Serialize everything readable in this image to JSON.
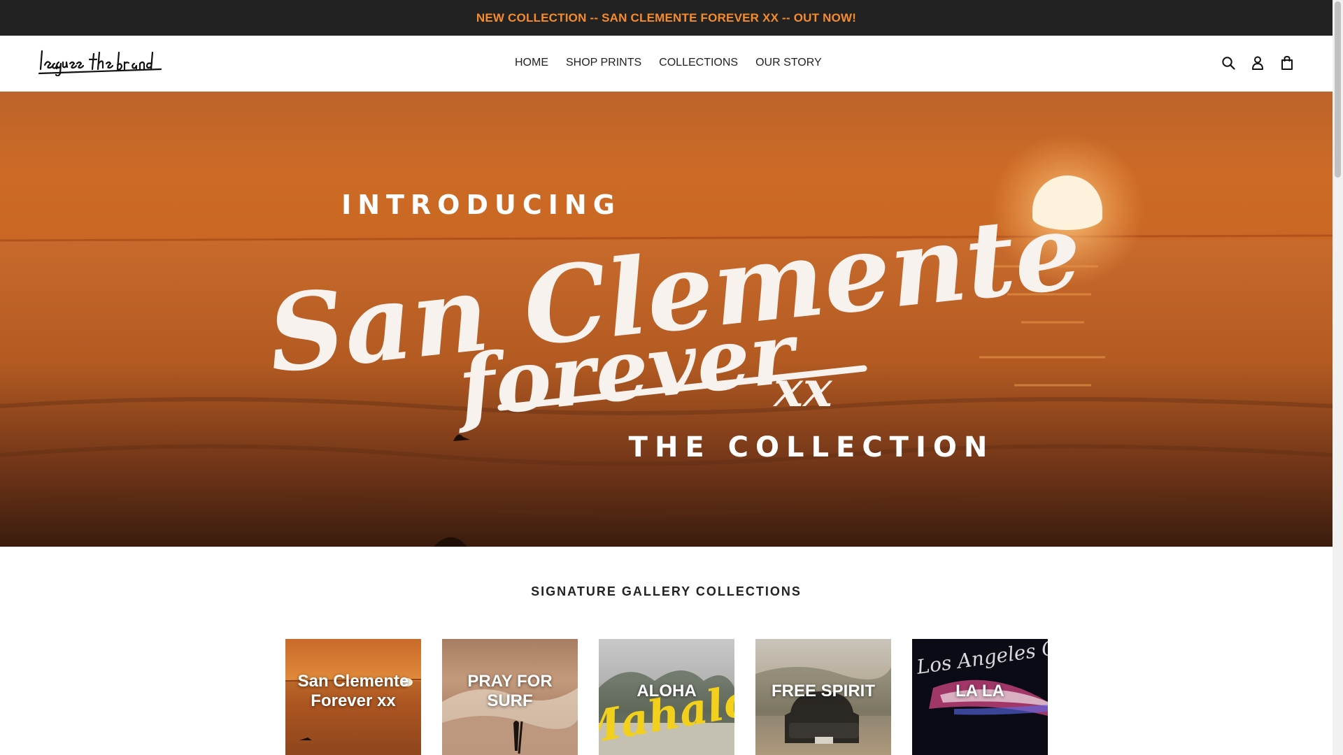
{
  "announcement": {
    "text": "NEW COLLECTION -- SAN CLEMENTE FOREVER XX -- OUT NOW!",
    "color": "#f68b2c"
  },
  "header": {
    "logo_text": "league the brand",
    "nav": [
      {
        "label": "HOME",
        "active": true
      },
      {
        "label": "SHOP PRINTS",
        "active": false
      },
      {
        "label": "COLLECTIONS",
        "active": false
      },
      {
        "label": "OUR STORY",
        "active": false
      }
    ],
    "icons": [
      "search-icon",
      "account-icon",
      "cart-icon"
    ]
  },
  "hero": {
    "line1": "INTRODUCING",
    "script1": "San Clemente",
    "script2": "forever",
    "script3": "xx",
    "line2": "THE COLLECTION"
  },
  "section": {
    "title": "SIGNATURE GALLERY COLLECTIONS",
    "collections": [
      {
        "label": "San Clemente Forever xx"
      },
      {
        "label": "PRAY FOR SURF"
      },
      {
        "label": "ALOHA"
      },
      {
        "label": "FREE SPIRIT"
      },
      {
        "label": "LA LA"
      }
    ]
  },
  "tile_art": {
    "aloha_script": "Mahalo",
    "lala_script": "Los Angeles City of Stars"
  }
}
